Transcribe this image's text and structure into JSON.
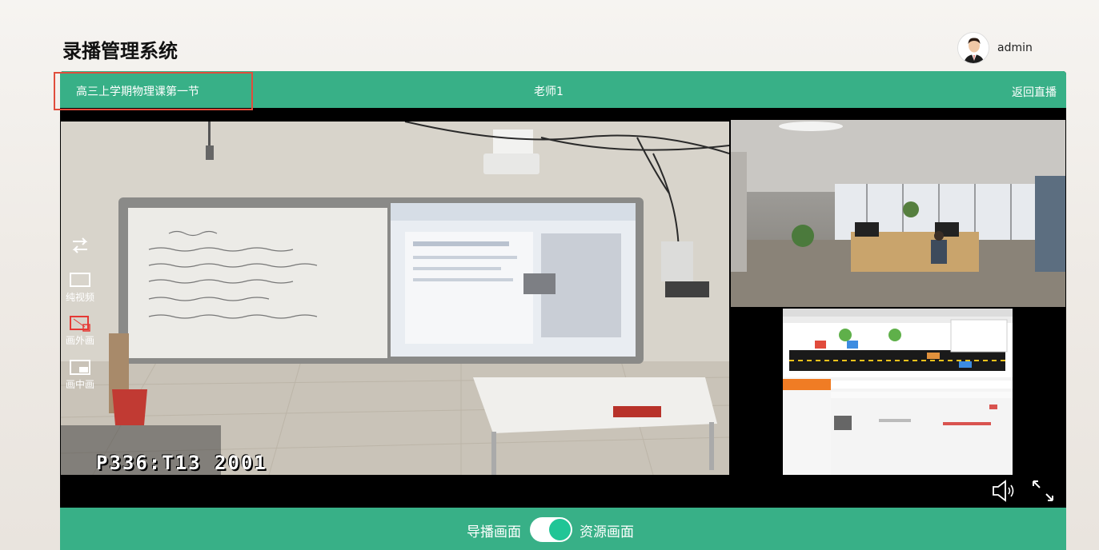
{
  "app": {
    "title": "录播管理系统"
  },
  "user": {
    "name": "admin"
  },
  "header": {
    "course_title": "高三上学期物理课第一节",
    "teacher": "老师1",
    "back_live": "返回直播"
  },
  "video": {
    "osd_text": "P336:T13  2001"
  },
  "tools": {
    "pure_video": "纯视频",
    "outside_pip": "画外画",
    "inside_pip": "画中画"
  },
  "footer": {
    "left_label": "导播画面",
    "right_label": "资源画面",
    "toggle_state": "on"
  },
  "colors": {
    "accent": "#38b087",
    "toggle_knob": "#20c596",
    "highlight": "#e04d3c"
  },
  "icons": {
    "swap": "swap-arrows-icon",
    "volume": "volume-icon",
    "fullscreen": "fullscreen-icon"
  }
}
